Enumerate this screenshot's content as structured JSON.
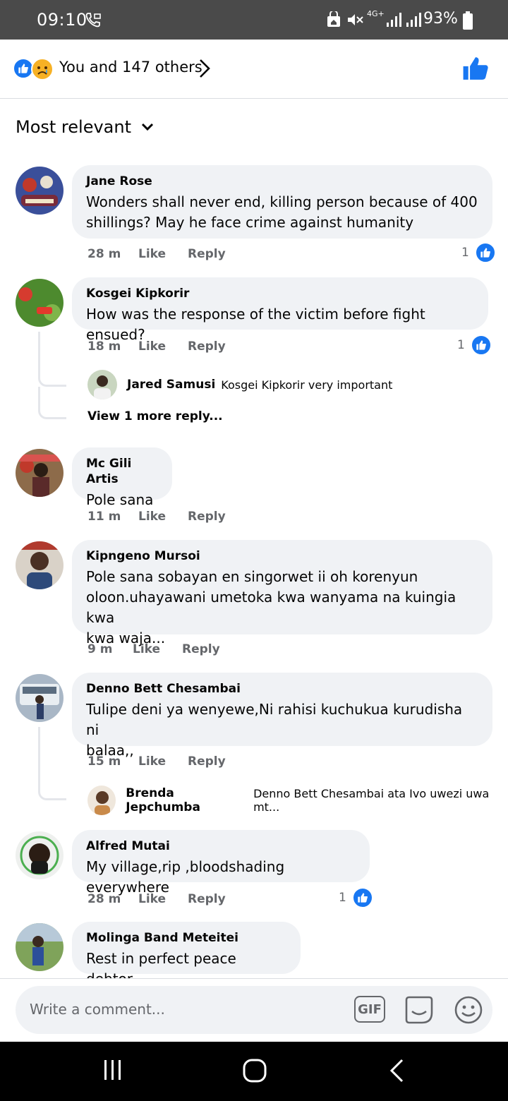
{
  "status_bar": {
    "time": "09:10",
    "battery": "93%",
    "network": "4G+"
  },
  "reactions": {
    "summary": "You and 147 others",
    "icons": [
      "like-icon",
      "sad-icon"
    ]
  },
  "filter": {
    "label": "Most relevant"
  },
  "comments": [
    {
      "name": "Jane Rose",
      "lines": [
        "Wonders shall never end, killing person because of 400",
        "shillings? May he face crime against humanity"
      ],
      "time": "28 m",
      "like": "Like",
      "reply": "Reply",
      "likes": "1"
    },
    {
      "name": "Kosgei Kipkorir",
      "lines": [
        "How was the response of the victim before fight ensued?"
      ],
      "time": "18 m",
      "like": "Like",
      "reply": "Reply",
      "likes": "1",
      "reply_preview": {
        "name": "Jared Samusi",
        "text": "Kosgei Kipkorir very important"
      },
      "view_more": "View 1 more reply..."
    },
    {
      "name": "Mc Gili Artis",
      "lines": [
        "Pole sana"
      ],
      "time": "11 m",
      "like": "Like",
      "reply": "Reply"
    },
    {
      "name": "Kipngeno Mursoi",
      "lines": [
        "Pole sana sobayan en singorwet ii oh korenyun",
        "oloon.uhayawani  umetoka kwa wanyama na kuingia kwa",
        "kwa waja..."
      ],
      "time": "9 m",
      "like": "Like",
      "reply": "Reply"
    },
    {
      "name": "Denno Bett Chesambai",
      "lines": [
        "Tulipe deni ya wenyewe,Ni rahisi kuchukua kurudisha ni",
        "balaa,,"
      ],
      "time": "15 m",
      "like": "Like",
      "reply": "Reply",
      "reply_preview": {
        "name": "Brenda Jepchumba",
        "text": "Denno Bett Chesambai ata Ivo uwezi uwa mt..."
      }
    },
    {
      "name": "Alfred Mutai",
      "lines": [
        "My village,rip ,bloodshading everywhere"
      ],
      "time": "28 m",
      "like": "Like",
      "reply": "Reply",
      "likes": "1"
    },
    {
      "name": "Molinga Band Meteitei",
      "lines": [
        "Rest in perfect peace debtor"
      ]
    }
  ],
  "composer": {
    "placeholder": "Write a comment...",
    "gif_label": "GIF"
  },
  "colors": {
    "accent": "#1877f2",
    "bubble": "#f0f2f5",
    "meta_text": "#65676b"
  }
}
